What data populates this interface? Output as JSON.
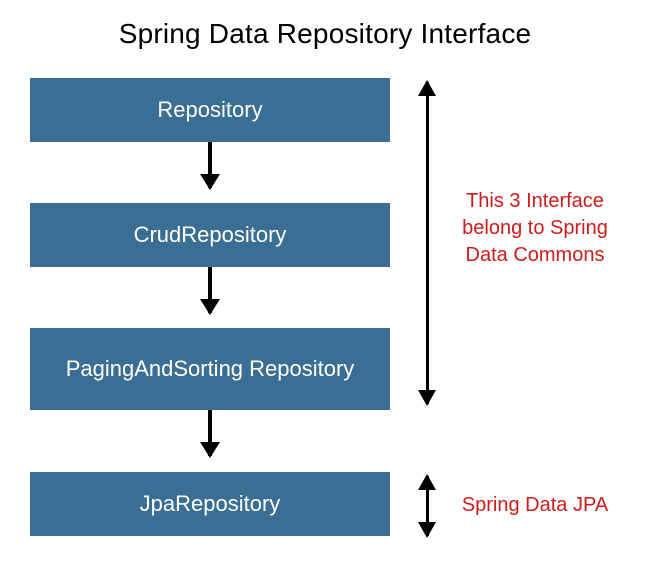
{
  "title": "Spring Data Repository Interface",
  "boxes": {
    "b1": "Repository",
    "b2": "CrudRepository",
    "b3": "PagingAndSorting Repository",
    "b4": "JpaRepository"
  },
  "brackets": {
    "top": "This 3 Interface belong to Spring Data Commons",
    "bottom": "Spring Data JPA"
  },
  "colors": {
    "box_fill": "#3a6e95",
    "box_text": "#ffffff",
    "label_text": "#d11b1b",
    "arrow": "#000000"
  }
}
